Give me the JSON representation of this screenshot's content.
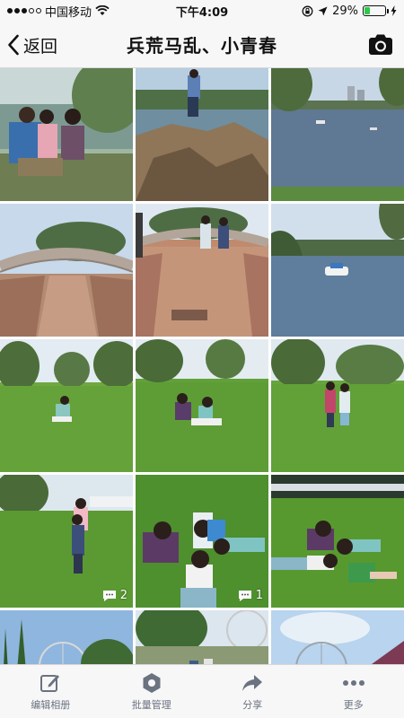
{
  "status_bar": {
    "carrier": "中国移动",
    "time": "下午4:09",
    "battery_percent": "29%",
    "battery_level": 0.29,
    "signal_bars": 3,
    "icons": [
      "wifi-icon",
      "rotation-lock-icon",
      "location-arrow-icon",
      "battery-icon",
      "charging-icon"
    ]
  },
  "nav": {
    "back_label": "返回",
    "title": "兵荒马乱、小青春",
    "right_icon": "camera-icon"
  },
  "photos": [
    {
      "scene": "friends-by-lake",
      "comments": ""
    },
    {
      "scene": "jump-on-rocks",
      "comments": ""
    },
    {
      "scene": "lake-view",
      "comments": ""
    },
    {
      "scene": "stone-bridge",
      "comments": ""
    },
    {
      "scene": "pair-on-bridge",
      "comments": ""
    },
    {
      "scene": "lake-boat",
      "comments": ""
    },
    {
      "scene": "girl-on-grass",
      "comments": ""
    },
    {
      "scene": "two-on-grass",
      "comments": ""
    },
    {
      "scene": "two-standing-lawn",
      "comments": ""
    },
    {
      "scene": "piggyback-lawn",
      "comments": "2"
    },
    {
      "scene": "lying-circle",
      "comments": "1"
    },
    {
      "scene": "lying-star",
      "comments": ""
    },
    {
      "scene": "ferris-wheel-trees",
      "comments": ""
    },
    {
      "scene": "park-path",
      "comments": ""
    },
    {
      "scene": "ferris-wheel-sky",
      "comments": ""
    }
  ],
  "toolbar": [
    {
      "label": "编辑相册",
      "icon": "edit-icon"
    },
    {
      "label": "批量管理",
      "icon": "manage-icon"
    },
    {
      "label": "分享",
      "icon": "share-icon"
    },
    {
      "label": "更多",
      "icon": "more-icon"
    }
  ],
  "colors": {
    "bar_background": "#f7f7f7",
    "icon_gray": "#6b7280",
    "battery_green": "#2ec94b"
  }
}
